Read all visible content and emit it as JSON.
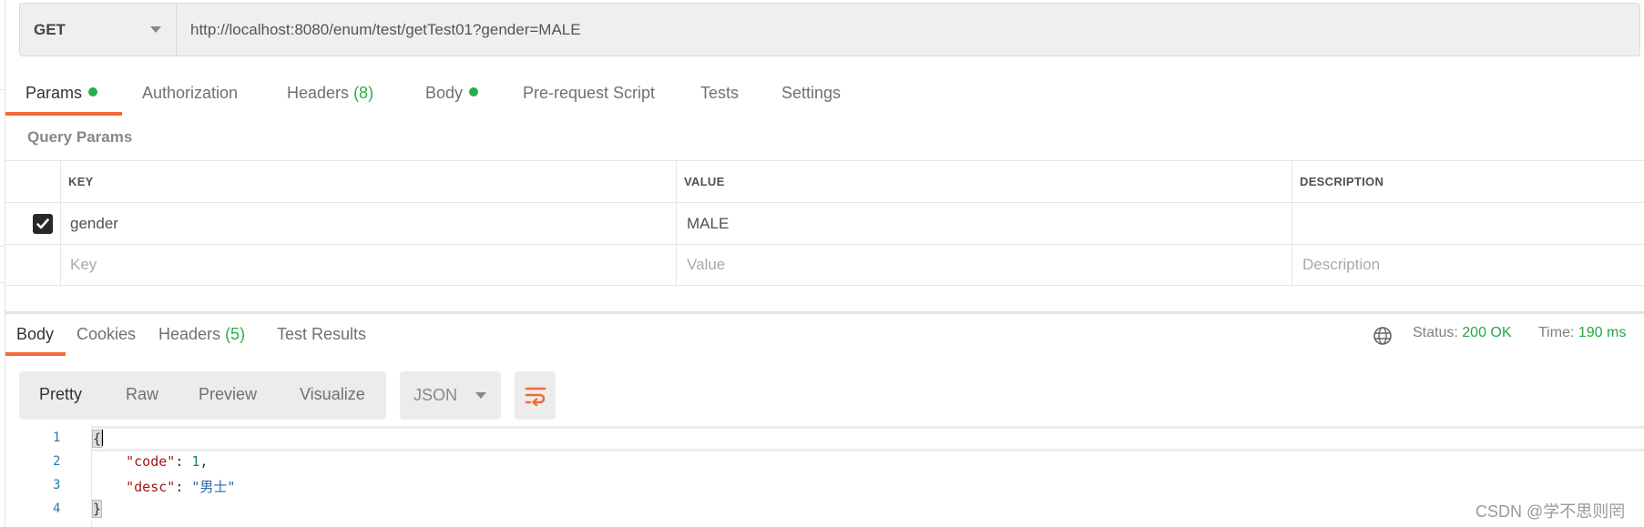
{
  "request": {
    "method": "GET",
    "url": "http://localhost:8080/enum/test/getTest01?gender=MALE"
  },
  "request_tabs": [
    {
      "label": "Params",
      "dot": true,
      "active": true
    },
    {
      "label": "Authorization"
    },
    {
      "label": "Headers",
      "count": "(8)"
    },
    {
      "label": "Body",
      "dot": true
    },
    {
      "label": "Pre-request Script"
    },
    {
      "label": "Tests"
    },
    {
      "label": "Settings"
    }
  ],
  "query_params": {
    "title": "Query Params",
    "columns": [
      "KEY",
      "VALUE",
      "DESCRIPTION"
    ],
    "rows": [
      {
        "checked": true,
        "key": "gender",
        "value": "MALE",
        "description": ""
      }
    ],
    "placeholders": {
      "key": "Key",
      "value": "Value",
      "description": "Description"
    }
  },
  "response_tabs": [
    {
      "label": "Body",
      "active": true
    },
    {
      "label": "Cookies"
    },
    {
      "label": "Headers",
      "count": "(5)"
    },
    {
      "label": "Test Results"
    }
  ],
  "response_status": {
    "status_label": "Status:",
    "status_value": "200 OK",
    "time_label": "Time:",
    "time_value": "190 ms",
    "colors": {
      "success": "#26a645"
    }
  },
  "view_modes": [
    "Pretty",
    "Raw",
    "Preview",
    "Visualize"
  ],
  "active_view_mode": "Pretty",
  "format": "JSON",
  "code_lines": [
    {
      "n": "1",
      "text": "{"
    },
    {
      "n": "2",
      "key": "\"code\"",
      "value": "1",
      "trail": ","
    },
    {
      "n": "3",
      "key": "\"desc\"",
      "value": "\"男士\""
    },
    {
      "n": "4",
      "text": "}"
    }
  ],
  "watermark": "CSDN @学不思则罔",
  "accent_color": "#f26b3a"
}
